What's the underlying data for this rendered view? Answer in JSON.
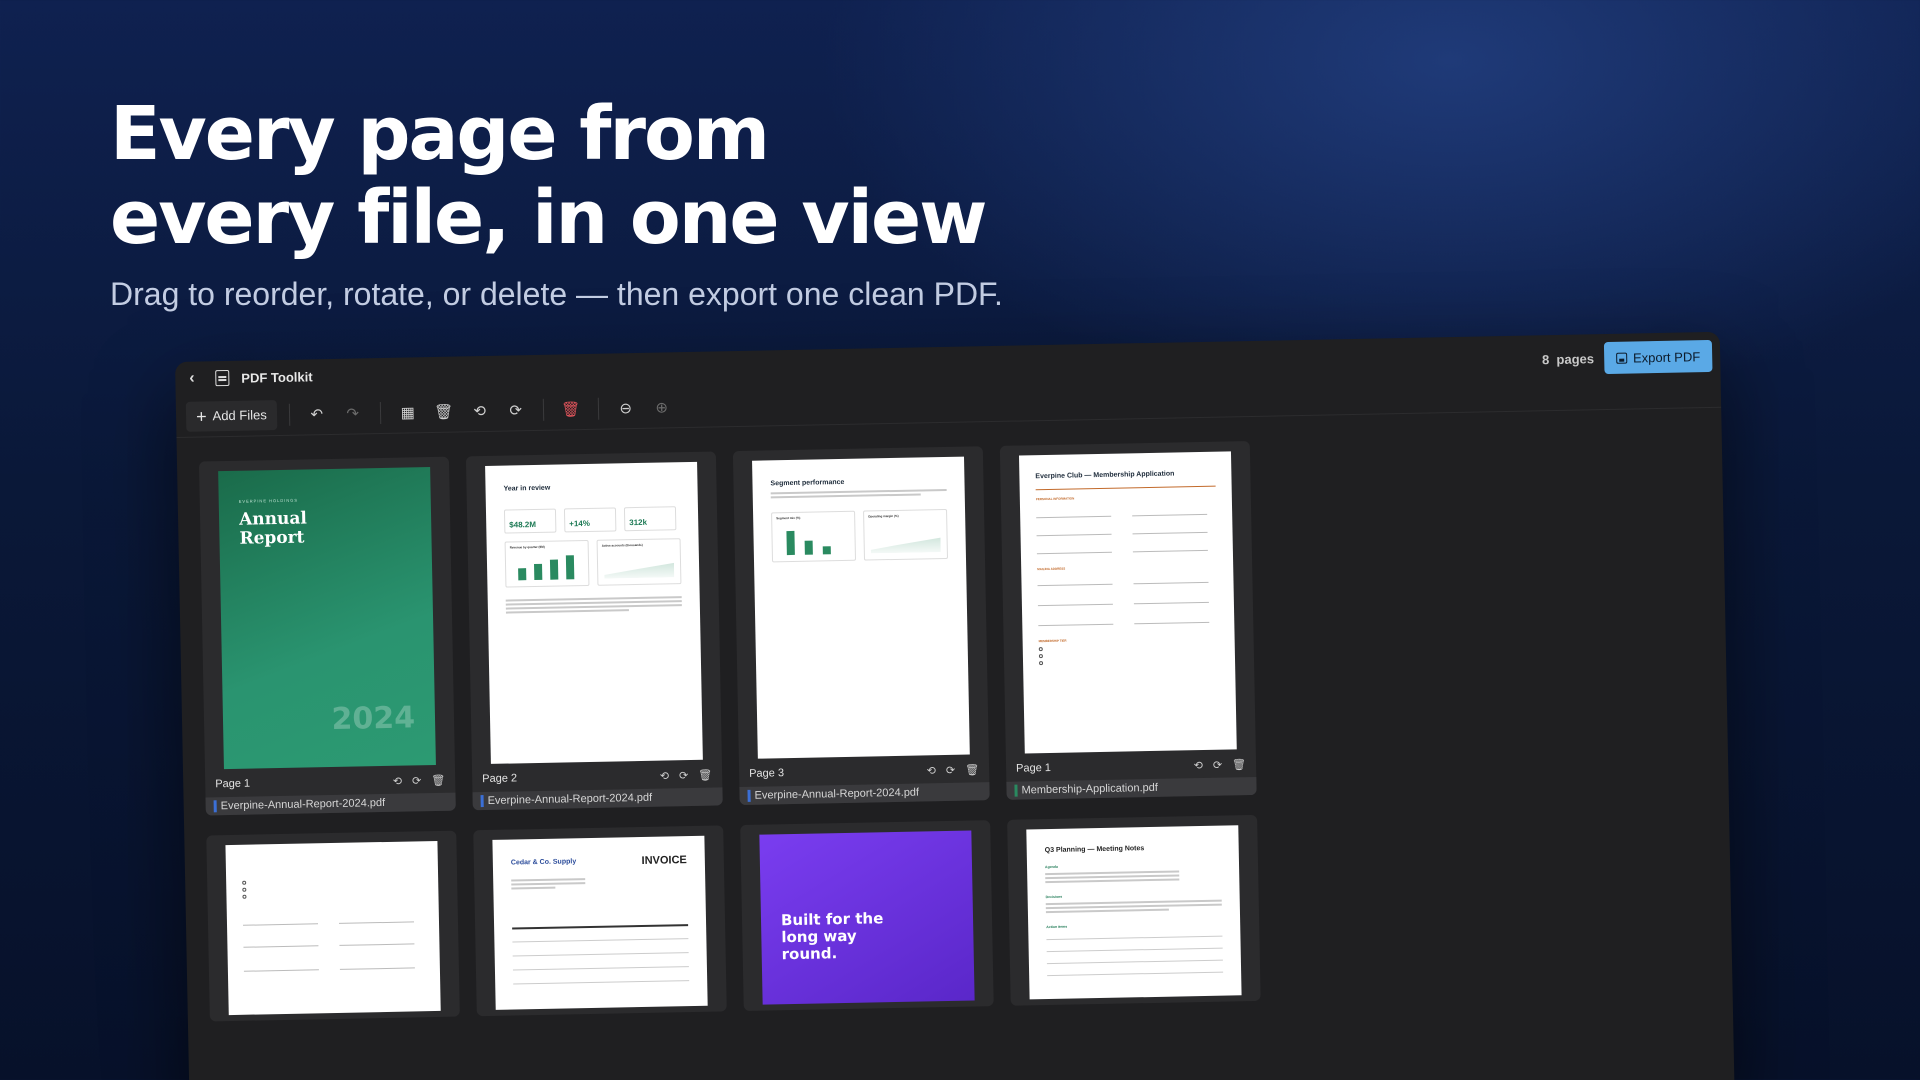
{
  "hero": {
    "title_line1": "Every page from",
    "title_line2": "every file, in one view",
    "subtitle": "Drag to reorder, rotate, or delete — then export one clean PDF."
  },
  "app": {
    "title": "PDF Toolkit",
    "page_count": "8",
    "page_count_unit": "pages",
    "export_label": "Export PDF",
    "add_files_label": "Add Files"
  },
  "toolbar_icons": [
    "undo-icon",
    "redo-icon",
    "select-all-icon",
    "delete-icon",
    "rotate-left-icon",
    "rotate-right-icon",
    "delete-all-icon",
    "zoom-out-icon",
    "zoom-in-icon"
  ],
  "colors": {
    "accent": "#5aa9e6",
    "danger": "#e0545b",
    "report_green": "#2a8a60",
    "form_orange": "#c26a2b",
    "purple": "#7a3df0"
  },
  "pages": [
    {
      "label": "Page 1",
      "file": "Everpine-Annual-Report-2024.pdf",
      "swatch": "#3b6fd6"
    },
    {
      "label": "Page 2",
      "file": "Everpine-Annual-Report-2024.pdf",
      "swatch": "#3b6fd6"
    },
    {
      "label": "Page 3",
      "file": "Everpine-Annual-Report-2024.pdf",
      "swatch": "#3b6fd6"
    },
    {
      "label": "Page 1",
      "file": "Membership-Application.pdf",
      "swatch": "#2a8a60"
    }
  ],
  "thumbs": {
    "cover": {
      "kicker": "EVERPINE HOLDINGS",
      "title1": "Annual",
      "title2": "Report",
      "year": "2024"
    },
    "review": {
      "heading": "Year in review",
      "kpi1": "$48.2M",
      "kpi2": "+14%",
      "kpi3": "312k",
      "chart1": "Revenue by quarter ($M)",
      "chart2": "Active accounts (thousands)"
    },
    "segment": {
      "heading": "Segment performance",
      "chart1": "Segment mix (%)",
      "chart2": "Operating margin (%)"
    },
    "form": {
      "heading": "Everpine Club — Membership Application",
      "sect1": "PERSONAL INFORMATION",
      "sect2": "MAILING ADDRESS",
      "sect3": "MEMBERSHIP TIER"
    },
    "invoice": {
      "company": "Cedar & Co. Supply",
      "heading": "INVOICE"
    },
    "promo": {
      "line1": "Built for the",
      "line2": "long way",
      "line3": "round."
    },
    "notes": {
      "heading": "Q3 Planning — Meeting Notes",
      "sect1": "Agenda",
      "sect2": "Decisions",
      "sect3": "Action items"
    }
  }
}
